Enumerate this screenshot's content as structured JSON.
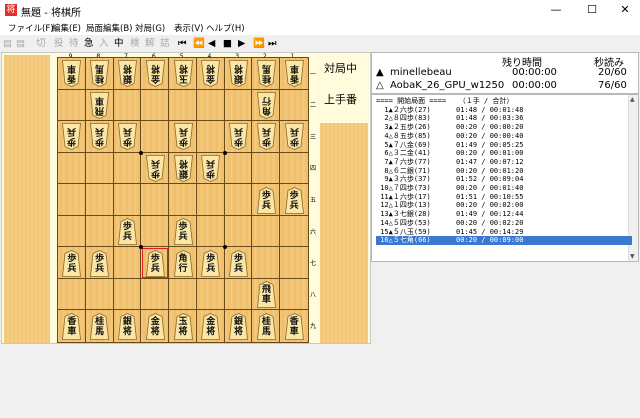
{
  "window": {
    "title": "無題 - 将棋所",
    "minimize": "—",
    "maximize": "☐",
    "close": "✕"
  },
  "menu": [
    "ファイル(F)",
    "編集(E)",
    "局面編集(B)",
    "対局(G)",
    "表示(V)",
    "ヘルプ(H)"
  ],
  "toolbar": [
    {
      "label": "▤",
      "enabled": false
    },
    {
      "label": "▤",
      "enabled": false
    },
    {
      "label": "切",
      "enabled": false
    },
    {
      "label": "投",
      "enabled": false
    },
    {
      "label": "待",
      "enabled": false
    },
    {
      "label": "急",
      "enabled": true
    },
    {
      "label": "入",
      "enabled": false
    },
    {
      "label": "中",
      "enabled": true
    },
    {
      "label": "検",
      "enabled": false
    },
    {
      "label": "解",
      "enabled": false
    },
    {
      "label": "詰",
      "enabled": false
    },
    {
      "label": "⏮",
      "enabled": true
    },
    {
      "label": "⏪",
      "enabled": true
    },
    {
      "label": "◀",
      "enabled": true
    },
    {
      "label": "■",
      "enabled": true
    },
    {
      "label": "▶",
      "enabled": true
    },
    {
      "label": "⏩",
      "enabled": true
    },
    {
      "label": "⏭",
      "enabled": true
    }
  ],
  "board": {
    "col_labels": [
      "9",
      "8",
      "7",
      "6",
      "5",
      "4",
      "3",
      "2",
      "1"
    ],
    "row_labels": [
      "一",
      "二",
      "三",
      "四",
      "五",
      "六",
      "七",
      "八",
      "九"
    ],
    "highlight": {
      "file": 6,
      "rank": 7
    },
    "pieces": [
      {
        "file": 9,
        "rank": 1,
        "side": "gote",
        "chars": [
          "香",
          "車"
        ]
      },
      {
        "file": 8,
        "rank": 1,
        "side": "gote",
        "chars": [
          "桂",
          "馬"
        ]
      },
      {
        "file": 7,
        "rank": 1,
        "side": "gote",
        "chars": [
          "銀",
          "将"
        ]
      },
      {
        "file": 6,
        "rank": 1,
        "side": "gote",
        "chars": [
          "金",
          "将"
        ]
      },
      {
        "file": 5,
        "rank": 1,
        "side": "gote",
        "chars": [
          "玉",
          "将"
        ]
      },
      {
        "file": 4,
        "rank": 1,
        "side": "gote",
        "chars": [
          "金",
          "将"
        ]
      },
      {
        "file": 3,
        "rank": 1,
        "side": "gote",
        "chars": [
          "銀",
          "将"
        ]
      },
      {
        "file": 2,
        "rank": 1,
        "side": "gote",
        "chars": [
          "桂",
          "馬"
        ]
      },
      {
        "file": 1,
        "rank": 1,
        "side": "gote",
        "chars": [
          "香",
          "車"
        ]
      },
      {
        "file": 8,
        "rank": 2,
        "side": "gote",
        "chars": [
          "飛",
          "車"
        ]
      },
      {
        "file": 2,
        "rank": 2,
        "side": "gote",
        "chars": [
          "角",
          "行"
        ]
      },
      {
        "file": 9,
        "rank": 3,
        "side": "gote",
        "chars": [
          "歩",
          "兵"
        ]
      },
      {
        "file": 8,
        "rank": 3,
        "side": "gote",
        "chars": [
          "歩",
          "兵"
        ]
      },
      {
        "file": 7,
        "rank": 3,
        "side": "gote",
        "chars": [
          "歩",
          "兵"
        ]
      },
      {
        "file": 5,
        "rank": 3,
        "side": "gote",
        "chars": [
          "歩",
          "兵"
        ]
      },
      {
        "file": 3,
        "rank": 3,
        "side": "gote",
        "chars": [
          "歩",
          "兵"
        ]
      },
      {
        "file": 2,
        "rank": 3,
        "side": "gote",
        "chars": [
          "歩",
          "兵"
        ]
      },
      {
        "file": 1,
        "rank": 3,
        "side": "gote",
        "chars": [
          "歩",
          "兵"
        ]
      },
      {
        "file": 6,
        "rank": 4,
        "side": "gote",
        "chars": [
          "歩",
          "兵"
        ]
      },
      {
        "file": 5,
        "rank": 4,
        "side": "gote",
        "chars": [
          "銀",
          "将"
        ]
      },
      {
        "file": 4,
        "rank": 4,
        "side": "gote",
        "chars": [
          "歩",
          "兵"
        ]
      },
      {
        "file": 2,
        "rank": 5,
        "side": "sente",
        "chars": [
          "歩",
          "兵"
        ]
      },
      {
        "file": 1,
        "rank": 5,
        "side": "sente",
        "chars": [
          "歩",
          "兵"
        ]
      },
      {
        "file": 7,
        "rank": 6,
        "side": "sente",
        "chars": [
          "歩",
          "兵"
        ]
      },
      {
        "file": 5,
        "rank": 6,
        "side": "sente",
        "chars": [
          "歩",
          "兵"
        ]
      },
      {
        "file": 9,
        "rank": 7,
        "side": "sente",
        "chars": [
          "歩",
          "兵"
        ]
      },
      {
        "file": 8,
        "rank": 7,
        "side": "sente",
        "chars": [
          "歩",
          "兵"
        ]
      },
      {
        "file": 6,
        "rank": 7,
        "side": "sente",
        "chars": [
          "歩",
          "兵"
        ]
      },
      {
        "file": 5,
        "rank": 7,
        "side": "sente",
        "chars": [
          "角",
          "行"
        ]
      },
      {
        "file": 4,
        "rank": 7,
        "side": "sente",
        "chars": [
          "歩",
          "兵"
        ]
      },
      {
        "file": 3,
        "rank": 7,
        "side": "sente",
        "chars": [
          "歩",
          "兵"
        ]
      },
      {
        "file": 2,
        "rank": 8,
        "side": "sente",
        "chars": [
          "飛",
          "車"
        ]
      },
      {
        "file": 9,
        "rank": 9,
        "side": "sente",
        "chars": [
          "香",
          "車"
        ]
      },
      {
        "file": 8,
        "rank": 9,
        "side": "sente",
        "chars": [
          "桂",
          "馬"
        ]
      },
      {
        "file": 7,
        "rank": 9,
        "side": "sente",
        "chars": [
          "銀",
          "将"
        ]
      },
      {
        "file": 6,
        "rank": 9,
        "side": "sente",
        "chars": [
          "金",
          "将"
        ]
      },
      {
        "file": 5,
        "rank": 9,
        "side": "sente",
        "chars": [
          "玉",
          "将"
        ]
      },
      {
        "file": 4,
        "rank": 9,
        "side": "sente",
        "chars": [
          "金",
          "将"
        ]
      },
      {
        "file": 3,
        "rank": 9,
        "side": "sente",
        "chars": [
          "銀",
          "将"
        ]
      },
      {
        "file": 2,
        "rank": 9,
        "side": "sente",
        "chars": [
          "桂",
          "馬"
        ]
      },
      {
        "file": 1,
        "rank": 9,
        "side": "sente",
        "chars": [
          "香",
          "車"
        ]
      }
    ]
  },
  "status": {
    "line1": "対局中",
    "line2": "上手番"
  },
  "players": {
    "header_time": "残り時間",
    "header_byoyomi": "秒読み",
    "sente": {
      "mark": "▲",
      "name": "minellebeau",
      "time": "00:00:00",
      "byoyomi": "20/60"
    },
    "gote": {
      "mark": "△",
      "name": "AobaK_26_GPU_w1250",
      "time": "00:00:00",
      "byoyomi": "76/60"
    }
  },
  "kifu": [
    "==== 開始局面 ====   （１手 / 合計）",
    "  1▲２六歩(27)      01:48 / 00:01:48",
    "  2△８四歩(83)      01:48 / 00:03:36",
    "  3▲２五歩(26)      00:20 / 00:00:20",
    "  4△８五歩(85)      00:20 / 00:00:40",
    "  5▲７八金(69)      01:49 / 00:05:25",
    "  6△３二金(41)      00:20 / 00:01:00",
    "  7▲７六歩(77)      01:47 / 00:07:12",
    "  8△６二銀(71)      00:20 / 00:01:20",
    "  9▲３六歩(37)      01:52 / 00:09:04",
    " 10△７四歩(73)      00:20 / 00:01:40",
    " 11▲１六歩(17)      01:51 / 00:10:55",
    " 12△１四歩(13)      00:20 / 00:02:00",
    " 13▲３七銀(28)      01:49 / 00:12:44",
    " 14△５四歩(53)      00:20 / 00:02:20",
    " 15▲５八玉(59)      01:45 / 00:14:29",
    " 16△５七角(66)      00:20 / 00:09:00"
  ],
  "kifu_selected": 16,
  "colors": {
    "selection": "#3a78d2",
    "board": "#f3c77b",
    "grid": "#6b4a1a"
  }
}
